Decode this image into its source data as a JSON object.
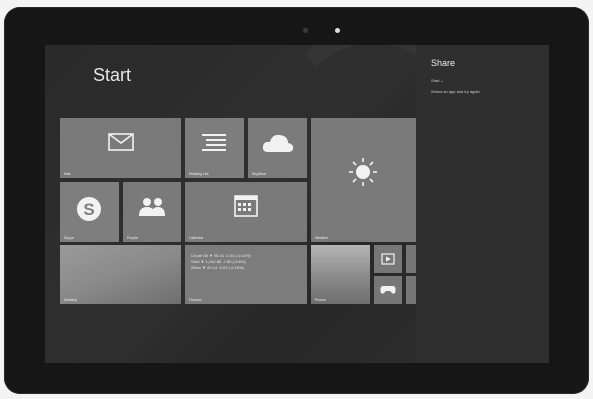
{
  "start": {
    "title": "Start"
  },
  "tiles": {
    "mail": "Mail",
    "reading_list": "Reading List",
    "skydrive": "SkyDrive",
    "skype": "Skype",
    "people": "People",
    "calendar": "Calendar",
    "weather": "Weather",
    "desktop": "Desktop",
    "finance": "Finance",
    "photos": "Photos"
  },
  "finance_rows": [
    "Crude Oil   ▼ 96.41 -0.04 (-0.04%)",
    "Gold        ▼ 1,242.80 -7.80 (-0.6%)",
    "Silver      ▼ 20.14 -0.03 (-0.15%)"
  ],
  "share": {
    "title": "Share",
    "app_selector": "Start ⌄",
    "message": "Select an app and try again."
  }
}
